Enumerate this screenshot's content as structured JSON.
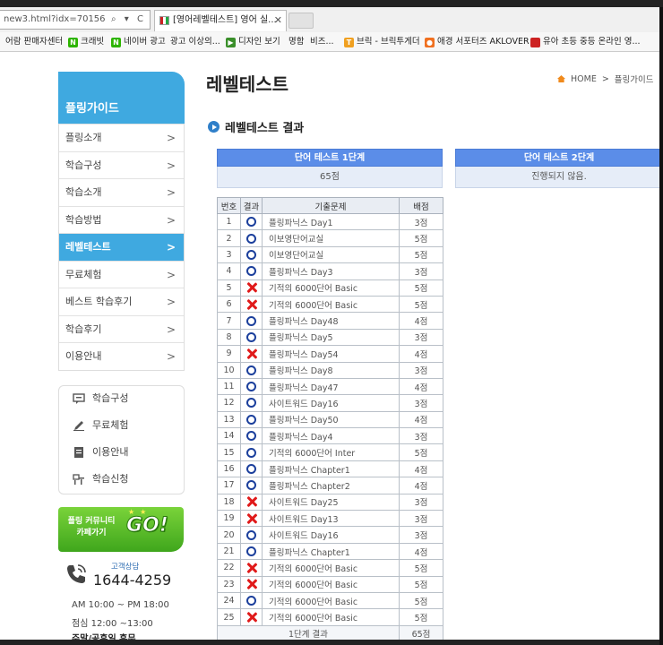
{
  "browser": {
    "address_text": "new3.html?idx=70156",
    "address_tools": "⌕ ▾ C",
    "tab_title": "[영어레벨테스트] 영어 실...",
    "tab_close": "✕",
    "favorites": [
      {
        "label": "어람 판매자센터",
        "icon": "none"
      },
      {
        "label": "크래빗",
        "icon": "naver-icon",
        "icon_text": "N",
        "color": "#2db400"
      },
      {
        "label": "네이버 광고",
        "icon": "naver-icon",
        "icon_text": "N",
        "color": "#2db400"
      },
      {
        "label": "광고 이상의...",
        "icon": "none"
      },
      {
        "label": "디자인 보기",
        "icon": "triangle-icon",
        "icon_text": "▶",
        "color": "#3a8f2a"
      },
      {
        "label": "명함",
        "icon": "none"
      },
      {
        "label": "비즈...",
        "icon": "none"
      },
      {
        "label": "브릭 - 브릭투게더",
        "icon": "brick-icon",
        "icon_text": "T",
        "color": "#f0a020"
      },
      {
        "label": "애경 서포터즈 AKLOVER",
        "icon": "aklover-icon",
        "icon_text": "●",
        "color": "#f07020"
      },
      {
        "label": "유아 초등 중등 온라인 영...",
        "icon": "flag-icon",
        "icon_text": "",
        "color": "#c22"
      }
    ]
  },
  "sidebar": {
    "title": "플링가이드",
    "items": [
      {
        "label": "플링소개",
        "active": false
      },
      {
        "label": "학습구성",
        "active": false
      },
      {
        "label": "학습소개",
        "active": false
      },
      {
        "label": "학습방법",
        "active": false
      },
      {
        "label": "레벨테스트",
        "active": true
      },
      {
        "label": "무료체험",
        "active": false
      },
      {
        "label": "베스트 학습후기",
        "active": false
      },
      {
        "label": "학습후기",
        "active": false
      },
      {
        "label": "이용안내",
        "active": false
      }
    ],
    "chevron": ">",
    "quick_links": [
      {
        "label": "학습구성",
        "icon": "chat-icon"
      },
      {
        "label": "무료체험",
        "icon": "pencil-icon"
      },
      {
        "label": "이용안내",
        "icon": "document-icon"
      },
      {
        "label": "학습신청",
        "icon": "signup-icon"
      }
    ],
    "community": {
      "line1": "플링 커뮤니티",
      "line2": "카페가기",
      "go": "GO!",
      "stars": "★★"
    },
    "cs_label": "고객상담",
    "phone": "1644-4259",
    "hours": [
      "AM 10:00 ~ PM 18:00",
      "점심 12:00 ~13:00",
      "주말/공휴일 휴무"
    ]
  },
  "main": {
    "title": "레벨테스트",
    "breadcrumb": [
      "HOME",
      "플링가이드"
    ],
    "breadcrumb_sep": ">",
    "section_title": "레벨테스트 결과",
    "stage1": {
      "head": "단어 테스트 1단계",
      "body": "65점"
    },
    "stage2": {
      "head": "단어 테스트 2단계",
      "body": "진행되지 않음."
    }
  },
  "table": {
    "headers": [
      "번호",
      "결과",
      "기출문제",
      "배점"
    ],
    "rows": [
      {
        "no": "1",
        "result": "O",
        "question": "플링파닉스 Day1",
        "score": "3점"
      },
      {
        "no": "2",
        "result": "O",
        "question": "이보영단어교실",
        "score": "5점"
      },
      {
        "no": "3",
        "result": "O",
        "question": "이보영단어교실",
        "score": "5점"
      },
      {
        "no": "4",
        "result": "O",
        "question": "플링파닉스 Day3",
        "score": "3점"
      },
      {
        "no": "5",
        "result": "X",
        "question": "기적의 6000단어 Basic",
        "score": "5점"
      },
      {
        "no": "6",
        "result": "X",
        "question": "기적의 6000단어 Basic",
        "score": "5점"
      },
      {
        "no": "7",
        "result": "O",
        "question": "플링파닉스 Day48",
        "score": "4점"
      },
      {
        "no": "8",
        "result": "O",
        "question": "플링파닉스 Day5",
        "score": "3점"
      },
      {
        "no": "9",
        "result": "X",
        "question": "플링파닉스 Day54",
        "score": "4점"
      },
      {
        "no": "10",
        "result": "O",
        "question": "플링파닉스 Day8",
        "score": "3점"
      },
      {
        "no": "11",
        "result": "O",
        "question": "플링파닉스 Day47",
        "score": "4점"
      },
      {
        "no": "12",
        "result": "O",
        "question": "사이트워드 Day16",
        "score": "3점"
      },
      {
        "no": "13",
        "result": "O",
        "question": "플링파닉스 Day50",
        "score": "4점"
      },
      {
        "no": "14",
        "result": "O",
        "question": "플링파닉스 Day4",
        "score": "3점"
      },
      {
        "no": "15",
        "result": "O",
        "question": "기적의 6000단어 Inter",
        "score": "5점"
      },
      {
        "no": "16",
        "result": "O",
        "question": "플링파닉스 Chapter1",
        "score": "4점"
      },
      {
        "no": "17",
        "result": "O",
        "question": "플링파닉스 Chapter2",
        "score": "4점"
      },
      {
        "no": "18",
        "result": "X",
        "question": "사이트워드 Day25",
        "score": "3점"
      },
      {
        "no": "19",
        "result": "X",
        "question": "사이트워드 Day13",
        "score": "3점"
      },
      {
        "no": "20",
        "result": "O",
        "question": "사이트워드 Day16",
        "score": "3점"
      },
      {
        "no": "21",
        "result": "O",
        "question": "플링파닉스 Chapter1",
        "score": "4점"
      },
      {
        "no": "22",
        "result": "X",
        "question": "기적의 6000단어 Basic",
        "score": "5점"
      },
      {
        "no": "23",
        "result": "X",
        "question": "기적의 6000단어 Basic",
        "score": "5점"
      },
      {
        "no": "24",
        "result": "O",
        "question": "기적의 6000단어 Basic",
        "score": "5점"
      },
      {
        "no": "25",
        "result": "X",
        "question": "기적의 6000단어 Basic",
        "score": "5점"
      }
    ],
    "total_label": "1단계 결과",
    "total_score": "65점"
  }
}
